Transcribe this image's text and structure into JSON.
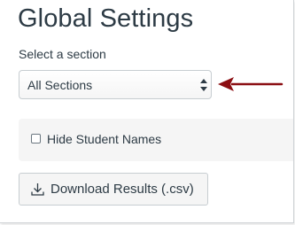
{
  "page": {
    "title": "Global Settings"
  },
  "section_select": {
    "label": "Select a section",
    "selected_value": "All Sections",
    "icon": "sort-arrows-icon"
  },
  "annotation": {
    "icon": "red-pointer-arrow",
    "color": "#8b0e12"
  },
  "hide_names": {
    "label": "Hide Student Names",
    "checked": false
  },
  "download": {
    "label": "Download Results (.csv)",
    "icon": "download-icon"
  },
  "colors": {
    "text": "#2d3b45",
    "panel_bg": "#f5f5f5",
    "border": "#c7cdd1"
  }
}
